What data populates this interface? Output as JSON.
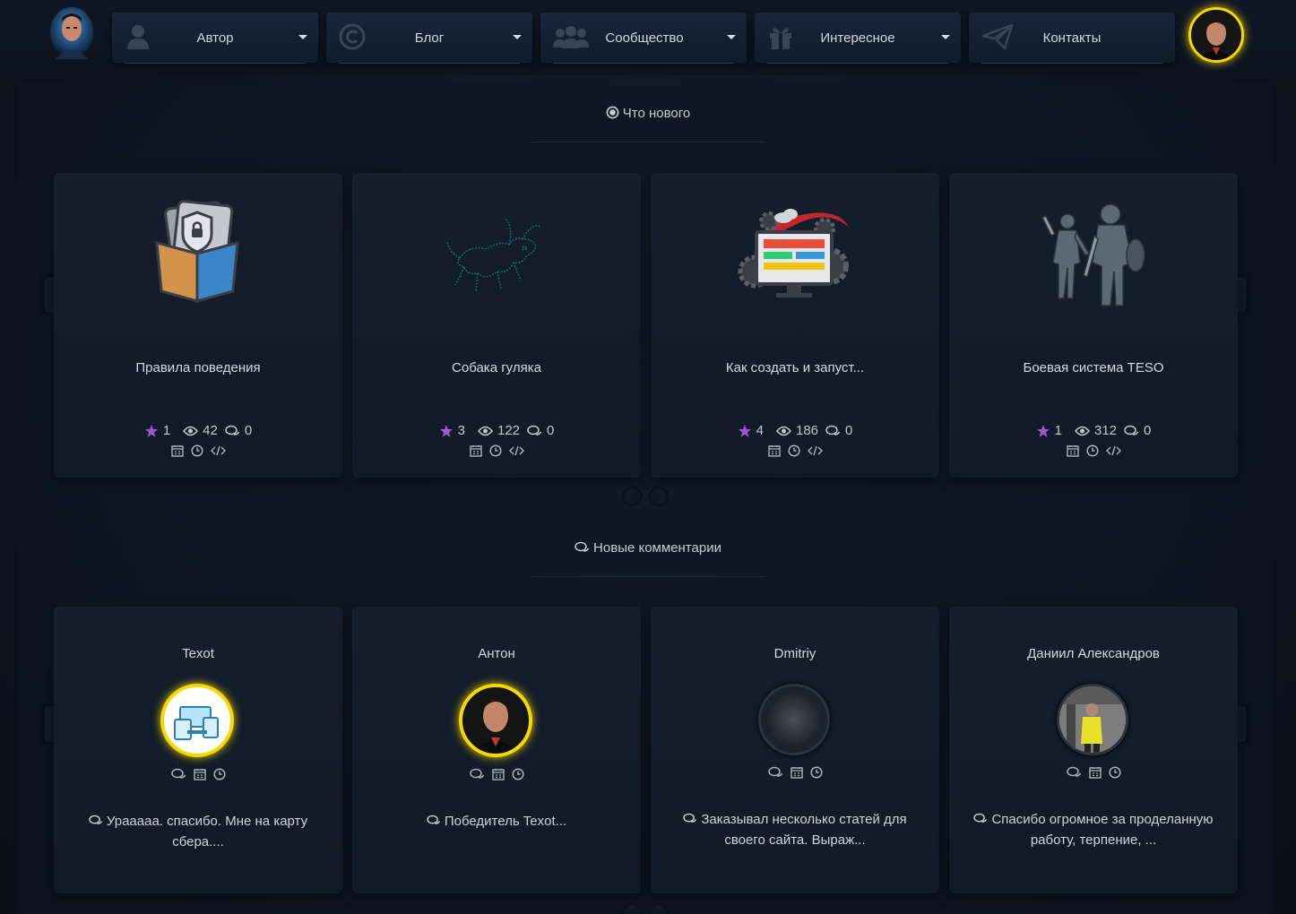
{
  "nav": {
    "items": [
      {
        "label": "Автор",
        "icon": "user-icon",
        "has_caret": true
      },
      {
        "label": "Блог",
        "icon": "copyright-icon",
        "has_caret": true
      },
      {
        "label": "Сообщество",
        "icon": "users-icon",
        "has_caret": true
      },
      {
        "label": "Интересное",
        "icon": "gift-icon",
        "has_caret": true
      },
      {
        "label": "Контакты",
        "icon": "paper-plane-icon",
        "has_caret": false
      }
    ]
  },
  "whats_new": {
    "heading": "Что нового",
    "prev_label": "«",
    "next_label": "»",
    "cards": [
      {
        "title": "Правила поведения",
        "rating": "1",
        "views": "42",
        "comments": "0",
        "image": "folder-lock-icon"
      },
      {
        "title": "Собака гуляка",
        "rating": "3",
        "views": "122",
        "comments": "0",
        "image": "dog-sketch-icon"
      },
      {
        "title": "Как создать и запуст...",
        "rating": "4",
        "views": "186",
        "comments": "0",
        "image": "computer-gears-icon"
      },
      {
        "title": "Боевая система TESO",
        "rating": "1",
        "views": "312",
        "comments": "0",
        "image": "warriors-icon"
      }
    ]
  },
  "new_comments": {
    "heading": "Новые комментарии",
    "prev_label": "«",
    "next_label": "»",
    "cards": [
      {
        "author": "Texot",
        "text": "Урааааа. спасибо. Мне на карту сбера....",
        "avatar": "devices-avatar"
      },
      {
        "author": "Антон",
        "text": "Победитель Texot...",
        "avatar": "man-avatar"
      },
      {
        "author": "Dmitriy",
        "text": "Заказывал несколько статей для своего сайта. Выраж...",
        "avatar": "blurred-avatar"
      },
      {
        "author": "Даниил Александров",
        "text": "Спасибо огромное за проделанную работу, терпение, ...",
        "avatar": "worker-avatar"
      }
    ]
  },
  "colors": {
    "accent_gold": "#f5d800",
    "arrow_green": "#3ad43a",
    "star_purple": "#9b59d0"
  }
}
